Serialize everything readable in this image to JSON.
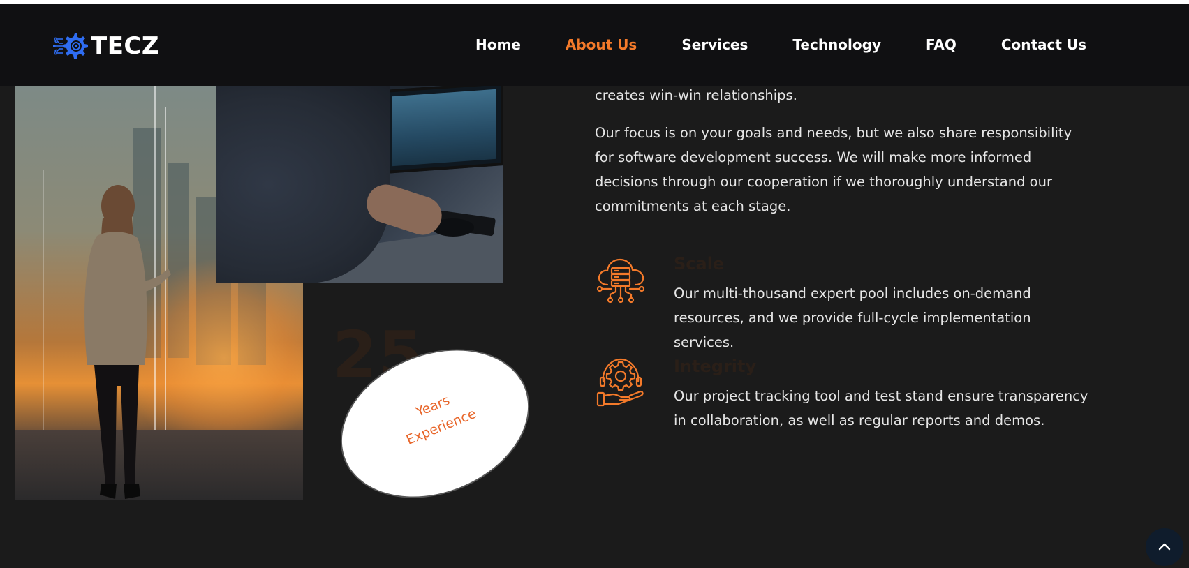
{
  "brand": {
    "name": "TECZ"
  },
  "nav": {
    "items": [
      {
        "label": "Home",
        "active": false
      },
      {
        "label": "About Us",
        "active": true
      },
      {
        "label": "Services",
        "active": false
      },
      {
        "label": "Technology",
        "active": false
      },
      {
        "label": "FAQ",
        "active": false
      },
      {
        "label": "Contact Us",
        "active": false
      }
    ]
  },
  "experience": {
    "number": "25",
    "line1": "Years",
    "line2": "Experience"
  },
  "content": {
    "para1": "creates win-win relationships.",
    "para2": "Our focus is on your goals and needs, but we also share responsibility for software development success. We will make more informed decisions through our cooperation if we thoroughly understand our commitments at each stage."
  },
  "features": [
    {
      "title": "Scale",
      "icon": "cloud-server-icon",
      "desc": "Our multi-thousand expert pool includes on-demand resources, and we provide full-cycle implementation services."
    },
    {
      "title": "Integrity",
      "icon": "gear-hand-icon",
      "desc": "Our project tracking tool and test stand ensure transparency in collaboration, as well as regular reports and demos."
    }
  ],
  "colors": {
    "accent": "#f47a2a",
    "background": "#1b1b1b",
    "navbar": "#101012",
    "logo_blue": "#2f6df2"
  },
  "scroll_top": {
    "icon": "chevron-up-icon"
  }
}
